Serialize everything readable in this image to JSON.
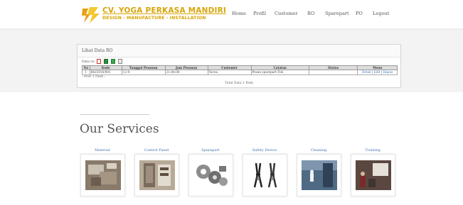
{
  "header": {
    "brand_title": "CV. YOGA PERKASA MANDIRI",
    "brand_subtitle": "DESIGN - MANUFACTURE - INSTALLATION",
    "brand_color": "#d7a40a",
    "nav": [
      "Home",
      "Profil",
      "Customer",
      "RO",
      "Sparepart",
      "PO",
      "Logout"
    ]
  },
  "panel": {
    "title": "Lihat Data RO",
    "data_label": "Data ro:",
    "export_icons": [
      "pdf-icon",
      "excel-icon",
      "csv-icon",
      "print-icon"
    ],
    "columns": [
      "No",
      "Kode",
      "Tanggal Pesanan",
      "Jam Pesanan",
      "Customer",
      "Catatan",
      "Status",
      "Menu"
    ],
    "rows": [
      {
        "no": "1",
        "kode": "RO/2016/001",
        "tanggal": "12-4-",
        "jam": "21:40:06",
        "customer": "Yavuu",
        "catatan": "Pesan sparepart Fok",
        "status": "",
        "menu": [
          "Detail",
          "Edit",
          "Hapus"
        ]
      }
    ],
    "pager": "- Prev 1 Next -",
    "total": "Total Data 1 Item"
  },
  "services": {
    "heading": "Our Services",
    "items": [
      {
        "label": "Material",
        "icon": "material-photo"
      },
      {
        "label": "Control Panel",
        "icon": "control-panel-photo"
      },
      {
        "label": "Sparepart",
        "icon": "sparepart-photo"
      },
      {
        "label": "Safety Device",
        "icon": "safety-device-photo"
      },
      {
        "label": "Cleaning",
        "icon": "cleaning-photo"
      },
      {
        "label": "Training",
        "icon": "training-photo"
      }
    ]
  }
}
